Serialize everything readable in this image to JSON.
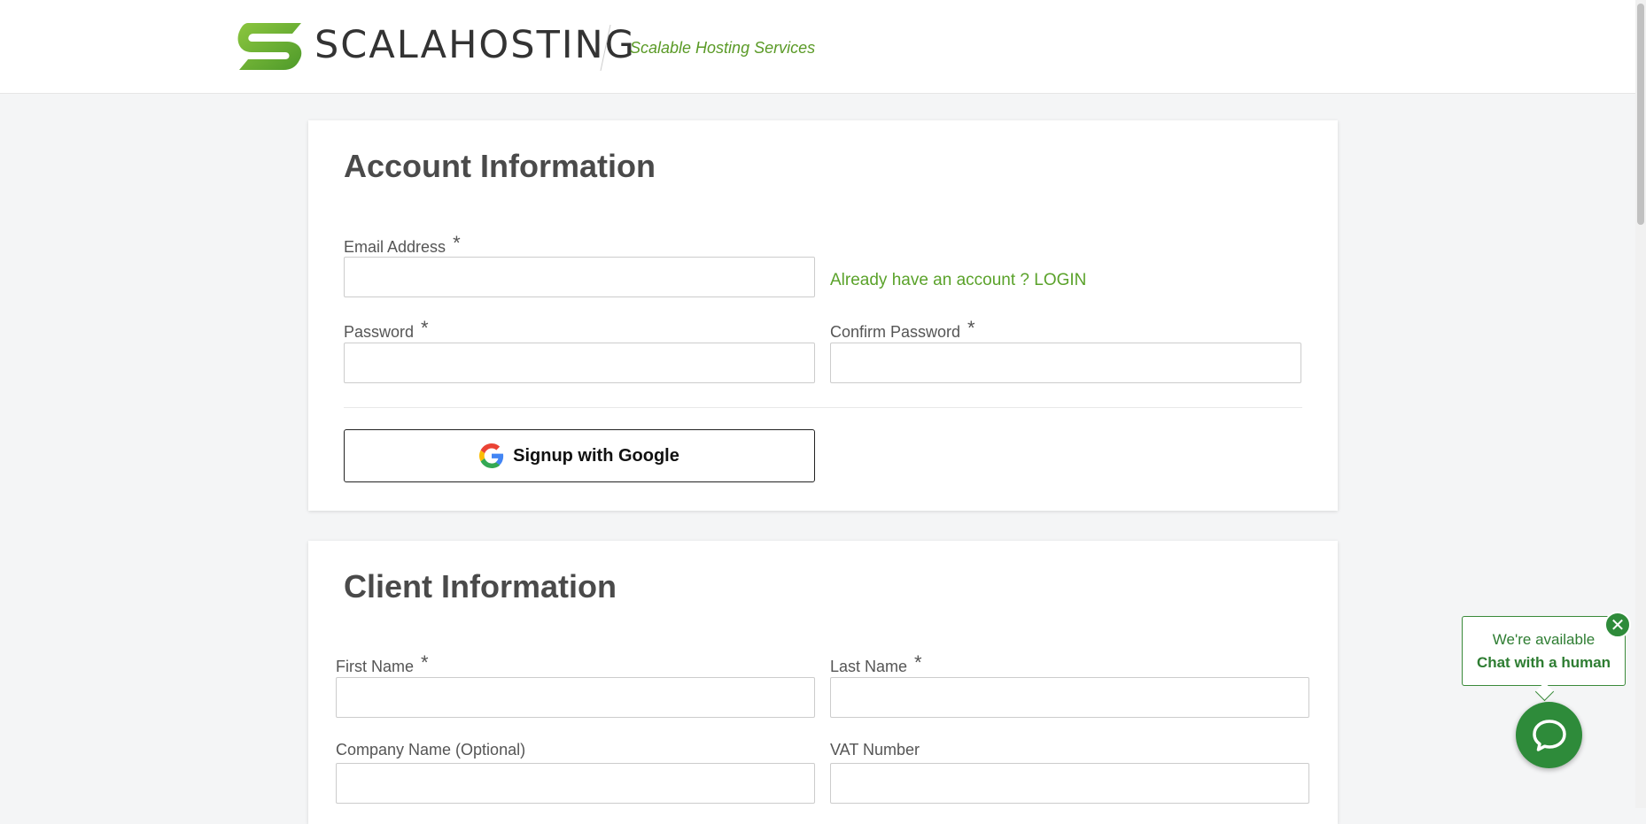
{
  "header": {
    "brand_name": "SCALAHOSTING",
    "tagline": "Scalable Hosting Services"
  },
  "account_section": {
    "title": "Account Information",
    "email_label": "Email Address",
    "email_value": "",
    "login_link": "Already have an account ? LOGIN",
    "password_label": "Password",
    "password_value": "",
    "confirm_password_label": "Confirm Password",
    "confirm_password_value": "",
    "google_button_label": "Signup with Google",
    "required_marker": "*"
  },
  "client_section": {
    "title": "Client Information",
    "first_name_label": "First Name",
    "first_name_value": "",
    "last_name_label": "Last Name",
    "last_name_value": "",
    "company_label": "Company Name (Optional)",
    "company_value": "",
    "vat_label": "VAT Number",
    "vat_value": "",
    "required_marker": "*"
  },
  "chat_widget": {
    "line1": "We're available",
    "line2": "Chat with a human",
    "close_icon": "close-icon",
    "launcher_icon": "chat-icon"
  },
  "colors": {
    "brand_green": "#5aa22a",
    "chat_green": "#2e8b3a"
  }
}
